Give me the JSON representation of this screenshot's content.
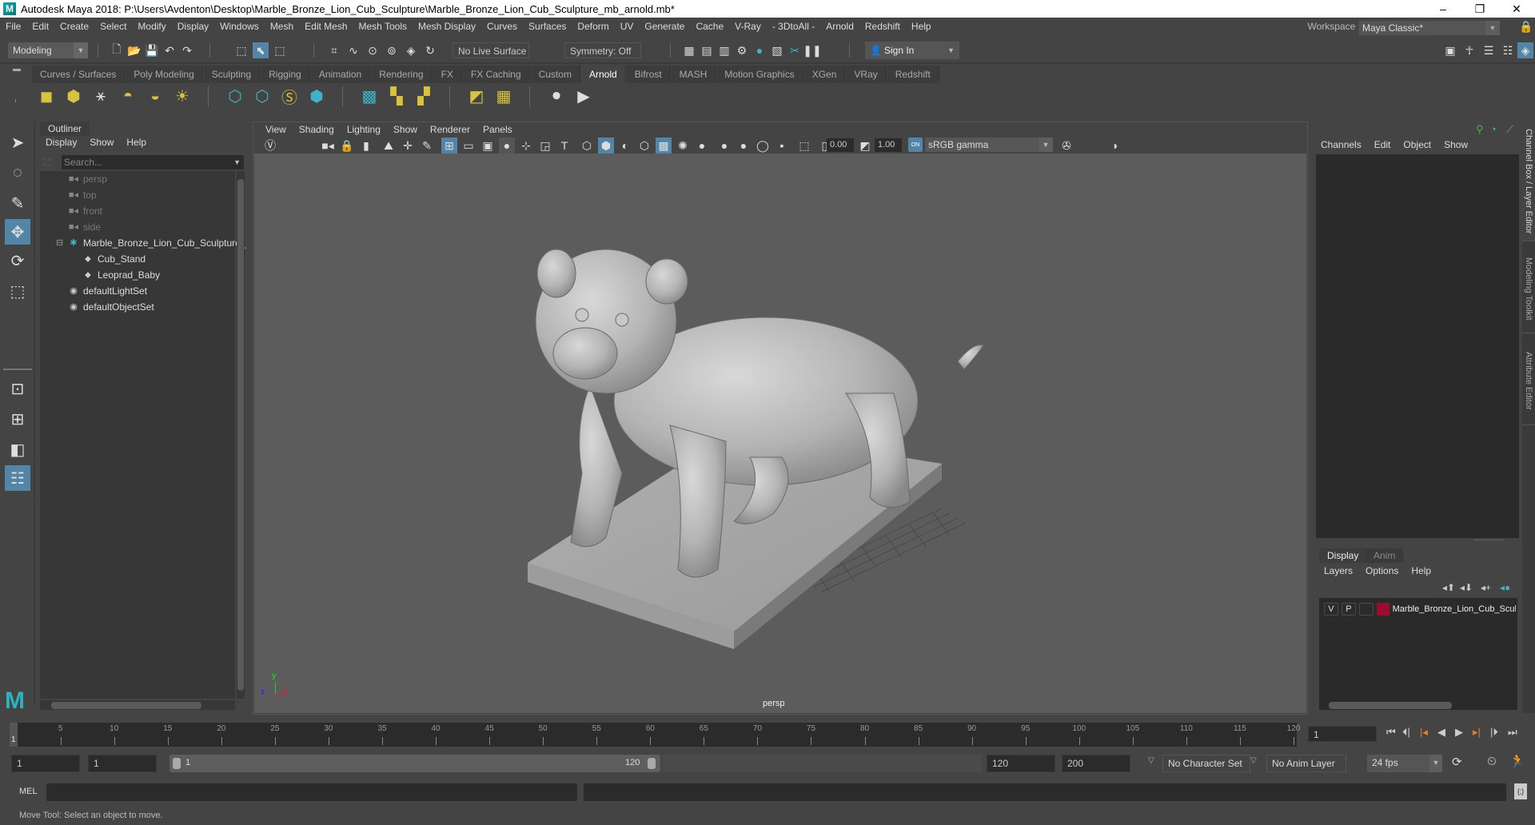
{
  "window": {
    "title": "Autodesk Maya 2018: P:\\Users\\Avdenton\\Desktop\\Marble_Bronze_Lion_Cub_Sculpture\\Marble_Bronze_Lion_Cub_Sculpture_mb_arnold.mb*",
    "app_logo": "M",
    "minimize": "–",
    "maximize": "❐",
    "close": "✕"
  },
  "menubar": [
    "File",
    "Edit",
    "Create",
    "Select",
    "Modify",
    "Display",
    "Windows",
    "Mesh",
    "Edit Mesh",
    "Mesh Tools",
    "Mesh Display",
    "Curves",
    "Surfaces",
    "Deform",
    "UV",
    "Generate",
    "Cache",
    "V-Ray",
    "- 3DtoAll -",
    "Arnold",
    "Redshift",
    "Help"
  ],
  "workspace": {
    "label": "Workspace :",
    "value": "Maya Classic*"
  },
  "statusline": {
    "mode": "Modeling",
    "live_surface": "No Live Surface",
    "symmetry": "Symmetry: Off",
    "sign_in": "Sign In"
  },
  "shelf": {
    "tabs": [
      "Curves / Surfaces",
      "Poly Modeling",
      "Sculpting",
      "Rigging",
      "Animation",
      "Rendering",
      "FX",
      "FX Caching",
      "Custom",
      "Arnold",
      "Bifrost",
      "MASH",
      "Motion Graphics",
      "XGen",
      "VRay",
      "Redshift"
    ],
    "active_tab": "Arnold"
  },
  "outliner": {
    "title": "Outliner",
    "menu": [
      "Display",
      "Show",
      "Help"
    ],
    "search_placeholder": "Search...",
    "items": [
      {
        "label": "persp",
        "type": "camera",
        "dim": true,
        "indent": 0
      },
      {
        "label": "top",
        "type": "camera",
        "dim": true,
        "indent": 0
      },
      {
        "label": "front",
        "type": "camera",
        "dim": true,
        "indent": 0
      },
      {
        "label": "side",
        "type": "camera",
        "dim": true,
        "indent": 0
      },
      {
        "label": "Marble_Bronze_Lion_Cub_Sculpture_",
        "type": "group",
        "dim": false,
        "indent": 0,
        "expanded": true
      },
      {
        "label": "Cub_Stand",
        "type": "mesh",
        "dim": false,
        "indent": 1
      },
      {
        "label": "Leoprad_Baby",
        "type": "mesh",
        "dim": false,
        "indent": 1
      },
      {
        "label": "defaultLightSet",
        "type": "set",
        "dim": false,
        "indent": 0
      },
      {
        "label": "defaultObjectSet",
        "type": "set",
        "dim": false,
        "indent": 0
      }
    ]
  },
  "viewport": {
    "menu": [
      "View",
      "Shading",
      "Lighting",
      "Show",
      "Renderer",
      "Panels"
    ],
    "exposure": "0.00",
    "gamma": "1.00",
    "color_mgmt_badge": "ON",
    "color_space": "sRGB gamma",
    "camera_label": "persp",
    "axes": {
      "x": "x",
      "y": "y",
      "z": "z"
    },
    "axis_colors": {
      "x": "#e02020",
      "y": "#20d020",
      "z": "#2030f0"
    }
  },
  "channel_box": {
    "menu": [
      "Channels",
      "Edit",
      "Object",
      "Show"
    ],
    "side_tabs": [
      "Channel Box / Layer Editor",
      "Modeling Toolkit",
      "Attribute Editor"
    ]
  },
  "layer_editor": {
    "tabs": [
      "Display",
      "Anim"
    ],
    "active_tab": "Display",
    "menu": [
      "Layers",
      "Options",
      "Help"
    ],
    "layers": [
      {
        "v": "V",
        "p": "P",
        "r": "",
        "color": "#9b0d2e",
        "name": "Marble_Bronze_Lion_Cub_Scul"
      }
    ]
  },
  "timeline": {
    "ticks": [
      5,
      10,
      15,
      20,
      25,
      30,
      35,
      40,
      45,
      50,
      55,
      60,
      65,
      70,
      75,
      80,
      85,
      90,
      95,
      100,
      105,
      110,
      115,
      120
    ],
    "start": 1,
    "end": 120,
    "current_frame_marker": "1",
    "current_frame": "1"
  },
  "range": {
    "start_time": "1",
    "playback_start": "1",
    "slider_min": "1",
    "slider_max": "120",
    "playback_end": "120",
    "end_time": "200",
    "character_set": "No Character Set",
    "anim_layer": "No Anim Layer",
    "fps": "24 fps"
  },
  "command_line": {
    "label": "MEL"
  },
  "help_line": "Move Tool: Select an object to move.",
  "colors": {
    "accent": "#5285a6",
    "maya_teal": "#3fb2c8",
    "shelf_yellow": "#d9c33e",
    "layer_color": "#9b0d2e"
  }
}
